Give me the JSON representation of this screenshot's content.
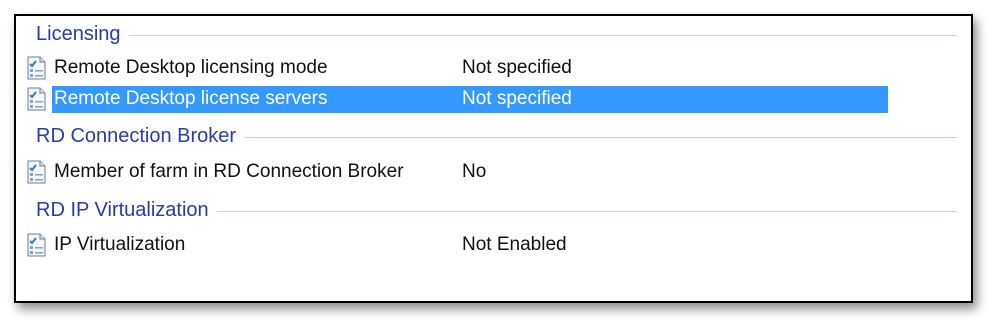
{
  "groups": [
    {
      "title": "Licensing",
      "items": [
        {
          "name": "Remote Desktop licensing mode",
          "value": "Not specified",
          "selected": false
        },
        {
          "name": "Remote Desktop license servers",
          "value": "Not specified",
          "selected": true
        }
      ]
    },
    {
      "title": "RD Connection Broker",
      "items": [
        {
          "name": "Member of farm in RD Connection Broker",
          "value": "No",
          "selected": false
        }
      ]
    },
    {
      "title": "RD IP Virtualization",
      "items": [
        {
          "name": "IP Virtualization",
          "value": "Not Enabled",
          "selected": false
        }
      ]
    }
  ],
  "colors": {
    "group_title": "#2a3ba8",
    "selection": "#3399ff"
  },
  "icons": {
    "setting": "policy-setting-icon"
  }
}
